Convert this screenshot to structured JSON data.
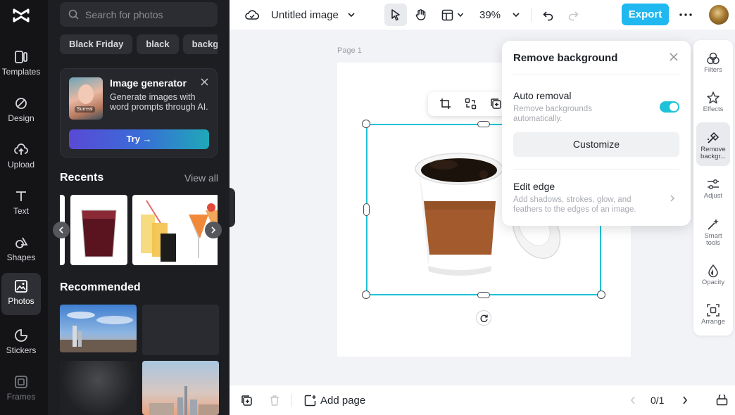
{
  "rail": {
    "items": [
      {
        "label": "Templates",
        "icon": "templates-icon"
      },
      {
        "label": "Design",
        "icon": "design-icon"
      },
      {
        "label": "Upload",
        "icon": "upload-icon"
      },
      {
        "label": "Text",
        "icon": "text-icon"
      },
      {
        "label": "Shapes",
        "icon": "shapes-icon"
      },
      {
        "label": "Photos",
        "icon": "photos-icon",
        "active": true
      },
      {
        "label": "Stickers",
        "icon": "stickers-icon"
      },
      {
        "label": "Frames",
        "icon": "frames-icon"
      }
    ]
  },
  "panel": {
    "search_placeholder": "Search for photos",
    "chips": [
      "Black Friday",
      "black",
      "background"
    ],
    "generator": {
      "title": "Image generator",
      "description": "Generate images with word prompts through AI.",
      "thumb_badge": "Surreal",
      "try_label": "Try →"
    },
    "recents_title": "Recents",
    "view_all": "View all",
    "recommended_title": "Recommended"
  },
  "topbar": {
    "title": "Untitled image",
    "zoom": "39%",
    "export_label": "Export"
  },
  "canvas": {
    "page_label": "Page 1"
  },
  "remove_bg": {
    "title": "Remove background",
    "auto_label": "Auto removal",
    "auto_desc": "Remove backgrounds automatically.",
    "auto_enabled": true,
    "customize_label": "Customize",
    "edit_edge_label": "Edit edge",
    "edit_edge_desc": "Add shadows, strokes, glow, and feathers to the edges of an image."
  },
  "right_tools": [
    {
      "label": "Filters",
      "icon": "filters-icon"
    },
    {
      "label": "Effects",
      "icon": "effects-icon"
    },
    {
      "label": "Remove backgr...",
      "icon": "remove-background-icon",
      "active": true
    },
    {
      "label": "Adjust",
      "icon": "adjust-icon"
    },
    {
      "label": "Smart tools",
      "icon": "smart-tools-icon"
    },
    {
      "label": "Opacity",
      "icon": "opacity-icon"
    },
    {
      "label": "Arrange",
      "icon": "arrange-icon"
    }
  ],
  "bottombar": {
    "add_page": "Add page",
    "page_count": "0/1"
  },
  "colors": {
    "accent": "#20b8f0",
    "selection": "#1fc2d6",
    "rail_bg": "#141417",
    "panel_bg": "#1d1e22"
  }
}
